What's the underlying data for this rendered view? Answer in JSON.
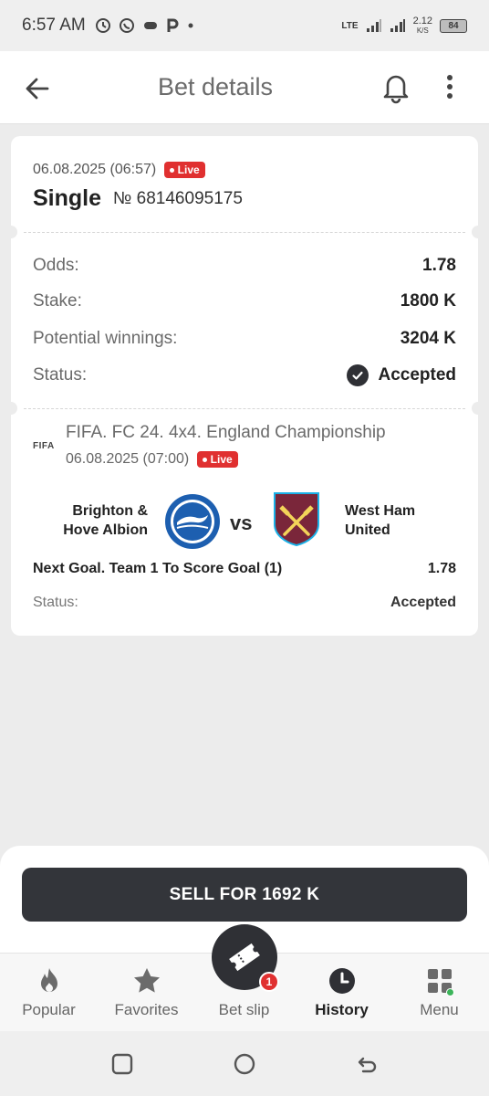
{
  "status_bar": {
    "time": "6:57 AM",
    "network": "LTE",
    "speed": "2.12",
    "speed_unit": "K/S",
    "battery": "84"
  },
  "header": {
    "title": "Bet details"
  },
  "bet": {
    "date": "06.08.2025 (06:57)",
    "live_label": "Live",
    "type": "Single",
    "number": "№ 68146095175",
    "odds_label": "Odds:",
    "odds_value": "1.78",
    "stake_label": "Stake:",
    "stake_value": "1800 K",
    "winnings_label": "Potential winnings:",
    "winnings_value": "3204 K",
    "status_label": "Status:",
    "status_value": "Accepted"
  },
  "event": {
    "league_logo": "FIFA",
    "tournament": "FIFA. FC 24. 4x4. England Championship",
    "date": "06.08.2025 (07:00)",
    "live_label": "Live",
    "team1": "Brighton & Hove Albion",
    "team2": "West Ham United",
    "vs": "vs",
    "market": "Next Goal. Team 1 To Score Goal (1)",
    "market_odds": "1.78",
    "status_label": "Status:",
    "status_value": "Accepted"
  },
  "sell": {
    "label": "SELL FOR 1692 K"
  },
  "nav": {
    "items": [
      {
        "label": "Popular",
        "icon": "flame-icon"
      },
      {
        "label": "Favorites",
        "icon": "star-icon"
      },
      {
        "label": "Bet slip",
        "icon": "ticket-icon",
        "badge": "1"
      },
      {
        "label": "History",
        "icon": "clock-icon"
      },
      {
        "label": "Menu",
        "icon": "grid-icon"
      }
    ],
    "active": "History"
  },
  "colors": {
    "live": "#e03030",
    "dark": "#33353a",
    "accent_green": "#3cb45a"
  }
}
